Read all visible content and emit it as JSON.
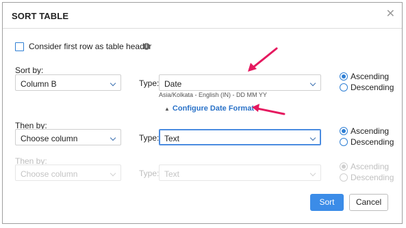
{
  "dialog": {
    "title": "SORT TABLE",
    "close_icon": "close-icon"
  },
  "header_row_option": {
    "label": "Consider first row as table header",
    "checked": false,
    "info_icon": "info-icon"
  },
  "sort_by": {
    "label": "Sort by:",
    "column": "Column B",
    "type_label": "Type:",
    "type": "Date",
    "date_hint": "Asia/Kolkata - English (IN) - DD MM YY",
    "configure_link": "Configure Date Format",
    "order": {
      "ascending": "Ascending",
      "descending": "Descending",
      "selected": "Ascending"
    }
  },
  "then_by_1": {
    "label": "Then by:",
    "column": "Choose column",
    "type_label": "Type:",
    "type": "Text",
    "order": {
      "ascending": "Ascending",
      "descending": "Descending",
      "selected": "Ascending"
    }
  },
  "then_by_2": {
    "label": "Then by:",
    "column": "Choose column",
    "type_label": "Type:",
    "type": "Text",
    "disabled": true,
    "order": {
      "ascending": "Ascending",
      "descending": "Descending",
      "selected": "Ascending"
    }
  },
  "buttons": {
    "sort": "Sort",
    "cancel": "Cancel"
  },
  "colors": {
    "accent": "#3b8ce8",
    "annotation_arrow": "#e5195f"
  }
}
